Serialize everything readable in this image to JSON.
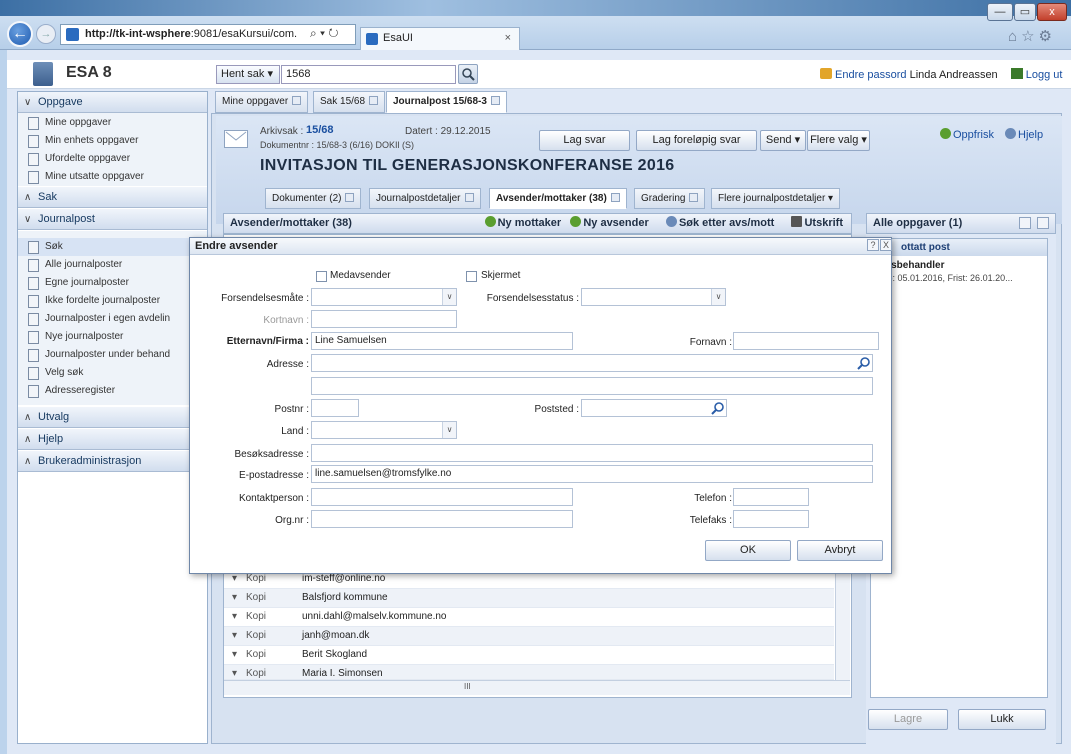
{
  "browser": {
    "url_host": "http://tk-int-wsphere",
    "url_rest": ":9081/esaKursui/com.",
    "tab_title": "EsaUI",
    "tab_close": "×",
    "window_buttons": [
      "—",
      "▭",
      "x"
    ]
  },
  "app": {
    "logo": "ESA 8",
    "hent_sak_label": "Hent sak",
    "search_value": "1568",
    "change_password": "Endre passord",
    "user_name": "Linda Andreassen",
    "logout": "Logg ut"
  },
  "sidebar": {
    "sections": [
      {
        "label": "Oppgave",
        "expanded": true
      },
      {
        "label": "Sak",
        "expanded": false
      },
      {
        "label": "Journalpost",
        "expanded": true
      },
      {
        "label": "Utvalg",
        "expanded": false
      },
      {
        "label": "Hjelp",
        "expanded": false
      },
      {
        "label": "Brukeradministrasjon",
        "expanded": false
      }
    ],
    "oppgave_items": [
      "Mine oppgaver",
      "Min enhets oppgaver",
      "Ufordelte oppgaver",
      "Mine utsatte oppgaver"
    ],
    "journalpost_items": [
      "Søk",
      "Alle journalposter",
      "Egne journalposter",
      "Ikke fordelte journalposter",
      "Journalposter i egen avdelin",
      "Nye journalposter",
      "Journalposter under behand",
      "Velg søk",
      "Adresseregister"
    ]
  },
  "main_tabs": [
    "Mine oppgaver",
    "Sak 15/68",
    "Journalpost 15/68-3"
  ],
  "journalpost": {
    "arkivsak_label": "Arkivsak :",
    "arkivsak_value": "15/68",
    "datert": "Datert : 29.12.2015",
    "dokumentnr": "Dokumentnr : 15/68-3 (6/16) DOKIl (S)",
    "title": "INVITASJON TIL GENERASJONSKONFERANSE 2016",
    "buttons": {
      "lag_svar": "Lag svar",
      "lag_forelopig": "Lag foreløpig svar",
      "send": "Send ▾",
      "flere_valg": "Flere valg ▾"
    },
    "oppfrisk": "Oppfrisk",
    "hjelp": "Hjelp"
  },
  "sub_tabs": [
    "Dokumenter (2)",
    "Journalpostdetaljer",
    "Avsender/mottaker (38)",
    "Gradering",
    "Flere journalpostdetaljer ▾"
  ],
  "list": {
    "title": "Avsender/mottaker (38)",
    "actions": [
      "Ny mottaker",
      "Ny avsender",
      "Søk etter avs/mott",
      "Utskrift"
    ],
    "rows": [
      {
        "type": "Kopi",
        "name": "im-steff@online.no"
      },
      {
        "type": "Kopi",
        "name": "Balsfjord kommune"
      },
      {
        "type": "Kopi",
        "name": "unni.dahl@malselv.kommune.no"
      },
      {
        "type": "Kopi",
        "name": "janh@moan.dk"
      },
      {
        "type": "Kopi",
        "name": "Berit Skogland"
      },
      {
        "type": "Kopi",
        "name": "Maria I. Simonsen"
      }
    ],
    "scroll_marker": "III"
  },
  "right_panel": {
    "title": "Alle oppgaver (1)",
    "box_header": "ottatt post",
    "line1": "aksbehandler",
    "line2": "ato: 05.01.2016, Frist: 26.01.20...",
    "lagre": "Lagre",
    "lukk": "Lukk"
  },
  "dialog": {
    "title": "Endre avsender",
    "help": "?",
    "close": "X",
    "medavsender": "Medavsender",
    "skjermet": "Skjermet",
    "forsendelsesmate_label": "Forsendelsesmåte :",
    "forsendelsesmate_value": "",
    "forsendelsesstatus_label": "Forsendelsesstatus :",
    "forsendelsesstatus_value": "",
    "kortnavn_label": "Kortnavn :",
    "kortnavn_value": "",
    "etternavn_label": "Etternavn/Firma :",
    "etternavn_value": "Line Samuelsen",
    "fornavn_label": "Fornavn :",
    "fornavn_value": "",
    "adresse_label": "Adresse :",
    "adresse_value": "",
    "adresse2_value": "",
    "postnr_label": "Postnr :",
    "postnr_value": "",
    "poststed_label": "Poststed :",
    "poststed_value": "",
    "land_label": "Land :",
    "land_value": "",
    "besoksadresse_label": "Besøksadresse :",
    "besoksadresse_value": "",
    "epost_label": "E-postadresse :",
    "epost_value": "line.samuelsen@tromsfylke.no",
    "kontakt_label": "Kontaktperson :",
    "kontakt_value": "",
    "telefon_label": "Telefon :",
    "telefon_value": "",
    "orgnr_label": "Org.nr :",
    "orgnr_value": "",
    "telefaks_label": "Telefaks :",
    "telefaks_value": "",
    "ok": "OK",
    "avbryt": "Avbryt"
  }
}
